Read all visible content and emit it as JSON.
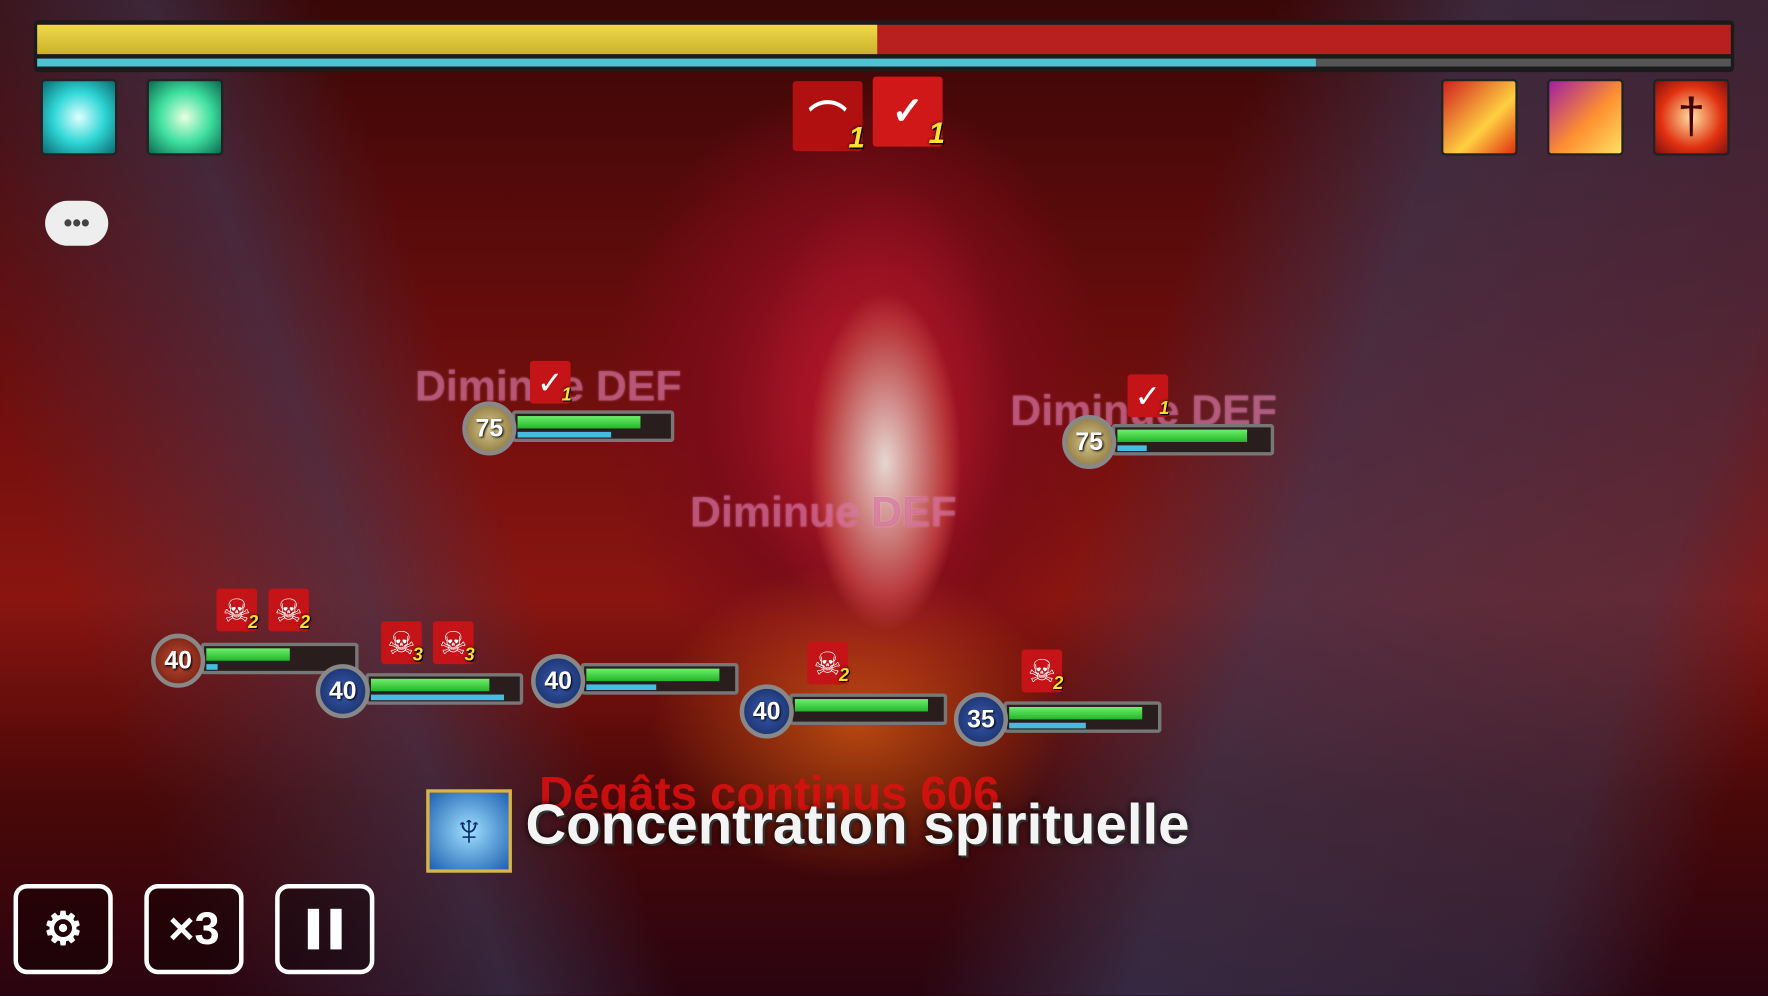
{
  "boss": {
    "hp_fraction": 0.496,
    "mana_fraction": 0.755,
    "buffs": [
      {
        "icon": "bat-wing-icon",
        "count": "1"
      },
      {
        "icon": "defense-break-icon",
        "count": "1"
      }
    ],
    "skills": [
      {
        "icon": "dragon-breath-icon"
      },
      {
        "icon": "dragon-roar-icon"
      },
      {
        "icon": "sword-icon"
      }
    ]
  },
  "team_effects": [
    {
      "icon": "cyan-spark-icon"
    },
    {
      "icon": "green-wings-icon"
    }
  ],
  "enemies": [
    {
      "level": "75",
      "hp": 0.85,
      "mana": 0.65,
      "debuff_count": "1"
    },
    {
      "level": "75",
      "hp": 0.9,
      "mana": 0.2,
      "debuff_count": "1"
    }
  ],
  "allies": [
    {
      "level": "40",
      "hp": 0.6,
      "mana": 0.08,
      "debuffs": [
        "2",
        "2"
      ]
    },
    {
      "level": "40",
      "hp": 0.85,
      "mana": 0.95,
      "debuffs": [
        "3",
        "3"
      ]
    },
    {
      "level": "40",
      "hp": 0.95,
      "mana": 0.5,
      "debuffs": []
    },
    {
      "level": "40",
      "hp": 0.95,
      "mana": 0.0,
      "debuffs": [
        "2"
      ]
    },
    {
      "level": "35",
      "hp": 0.95,
      "mana": 0.55,
      "debuffs": [
        "2"
      ]
    }
  ],
  "floating": {
    "def_down_1": "Diminue DEF",
    "def_down_2": "Diminue DEF",
    "def_down_3": "Diminue DEF",
    "damage": "Dégâts continus 606"
  },
  "skill_banner": {
    "text": "Concentration spirituelle"
  },
  "controls": {
    "speed": "×3",
    "chat": "•••"
  }
}
